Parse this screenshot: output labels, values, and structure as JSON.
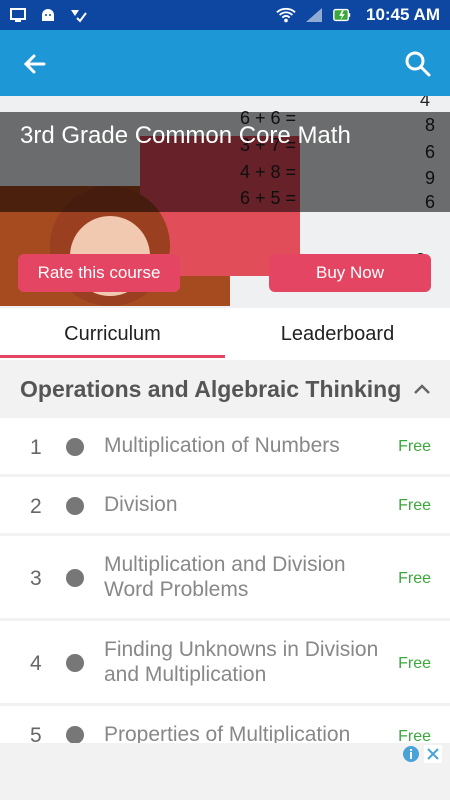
{
  "status": {
    "time": "10:45 AM"
  },
  "appbar": {
    "back_icon": "back-arrow-icon",
    "search_icon": "search-icon"
  },
  "hero": {
    "title": "3rd Grade Common Core Math",
    "rate_label": "Rate this course",
    "buy_label": "Buy Now"
  },
  "tabs": [
    {
      "label": "Curriculum",
      "active": true
    },
    {
      "label": "Leaderboard",
      "active": false
    }
  ],
  "section": {
    "title": "Operations and Algebraic Thinking"
  },
  "lessons": [
    {
      "number": "1",
      "title": "Multiplication of Numbers",
      "badge": "Free"
    },
    {
      "number": "2",
      "title": "Division",
      "badge": "Free"
    },
    {
      "number": "3",
      "title": "Multiplication and Division Word Problems",
      "badge": "Free"
    },
    {
      "number": "4",
      "title": "Finding Unknowns in Division and Multiplication",
      "badge": "Free"
    },
    {
      "number": "5",
      "title": "Properties of Multiplication",
      "badge": "Free"
    }
  ],
  "colors": {
    "appbar": "#1e97d6",
    "accent": "#e34563",
    "free": "#3aa83a"
  }
}
